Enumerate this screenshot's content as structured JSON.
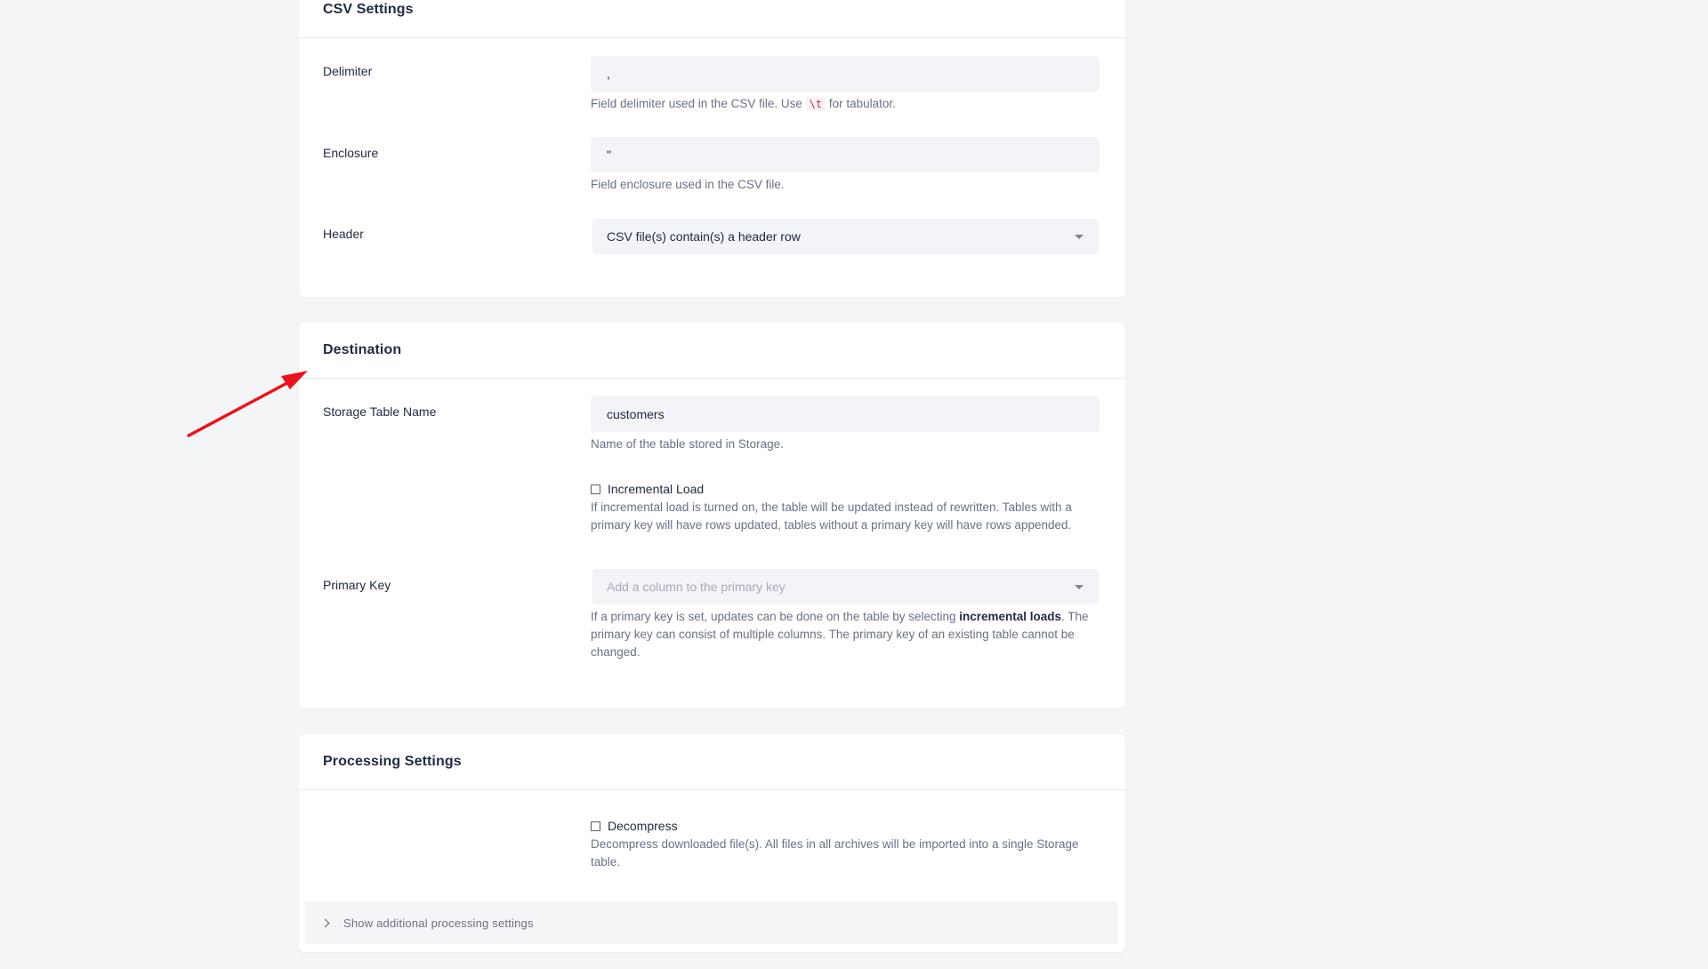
{
  "csv_settings": {
    "title": "CSV Settings",
    "delimiter": {
      "label": "Delimiter",
      "value": ",",
      "help_prefix": "Field delimiter used in the CSV file. Use ",
      "help_code": "\\t",
      "help_suffix": " for tabulator."
    },
    "enclosure": {
      "label": "Enclosure",
      "value": "\"",
      "help": "Field enclosure used in the CSV file."
    },
    "header": {
      "label": "Header",
      "selected": "CSV file(s) contain(s) a header row"
    }
  },
  "destination": {
    "title": "Destination",
    "storage_table": {
      "label": "Storage Table Name",
      "value": "customers",
      "help": "Name of the table stored in Storage."
    },
    "incremental_load": {
      "label": "Incremental Load",
      "checked": false,
      "help": "If incremental load is turned on, the table will be updated instead of rewritten. Tables with a primary key will have rows updated, tables without a primary key will have rows appended."
    },
    "primary_key": {
      "label": "Primary Key",
      "placeholder": "Add a column to the primary key",
      "help_prefix": "If a primary key is set, updates can be done on the table by selecting ",
      "help_bold": "incremental loads",
      "help_suffix": ". The primary key can consist of multiple columns. The primary key of an existing table cannot be changed."
    }
  },
  "processing_settings": {
    "title": "Processing Settings",
    "decompress": {
      "label": "Decompress",
      "checked": false,
      "help": "Decompress downloaded file(s). All files in all archives will be imported into a single Storage table."
    },
    "additional_toggle": "Show additional processing settings"
  },
  "annotation": {
    "arrow_color": "#e8141b"
  }
}
